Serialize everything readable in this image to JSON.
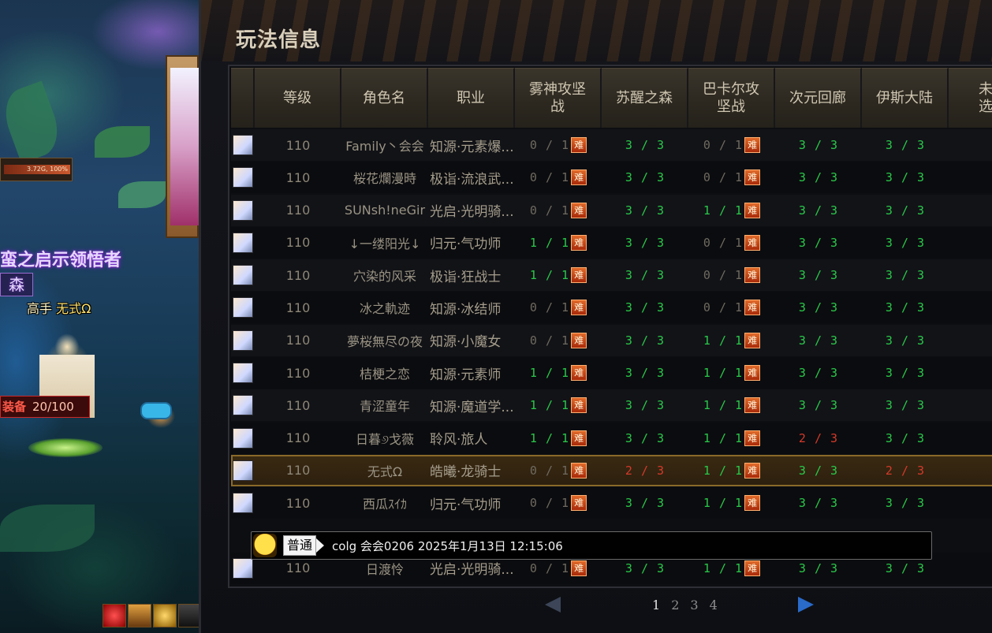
{
  "scene": {
    "gauge_text": "3.72G, 100%",
    "title": "蛮之启示领悟者",
    "subtitle": "森",
    "player_rank": "高手",
    "player_name": "无式Ω",
    "equip_label": "装备",
    "equip_count": "20/100"
  },
  "panel": {
    "title": "玩法信息",
    "headers": [
      "等级",
      "角色名",
      "职业",
      "雾神攻坚战",
      "苏醒之森",
      "巴卡尔攻坚战",
      "次元回廊",
      "伊斯大陆",
      "未选"
    ],
    "hard_tag": "难",
    "rows": [
      {
        "level": "110",
        "name": "Family丶会会",
        "job": "知源·元素爆...",
        "p1": "0 / 1",
        "p1c": "w",
        "p2": "3 / 3",
        "p2c": "g",
        "p3": "0 / 1",
        "p3c": "w",
        "p4": "3 / 3",
        "p4c": "g",
        "p5": "3 / 3",
        "p5c": "g",
        "last": "-"
      },
      {
        "level": "110",
        "name": "桜花爛漫時",
        "job": "极诣·流浪武...",
        "p1": "0 / 1",
        "p1c": "w",
        "p2": "3 / 3",
        "p2c": "g",
        "p3": "0 / 1",
        "p3c": "w",
        "p4": "3 / 3",
        "p4c": "g",
        "p5": "3 / 3",
        "p5c": "g",
        "last": "-"
      },
      {
        "level": "110",
        "name": "SUNsh!neGir",
        "job": "光启·光明骑...",
        "p1": "0 / 1",
        "p1c": "w",
        "p2": "3 / 3",
        "p2c": "g",
        "p3": "1 / 1",
        "p3c": "g",
        "p4": "3 / 3",
        "p4c": "g",
        "p5": "3 / 3",
        "p5c": "g",
        "last": "-"
      },
      {
        "level": "110",
        "name": "↓一缕阳光↓",
        "job": "归元·气功师",
        "p1": "1 / 1",
        "p1c": "g",
        "p2": "3 / 3",
        "p2c": "g",
        "p3": "0 / 1",
        "p3c": "w",
        "p4": "3 / 3",
        "p4c": "g",
        "p5": "3 / 3",
        "p5c": "g",
        "last": "-"
      },
      {
        "level": "110",
        "name": "穴染的风采",
        "job": "极诣·狂战士",
        "p1": "1 / 1",
        "p1c": "g",
        "p2": "3 / 3",
        "p2c": "g",
        "p3": "0 / 1",
        "p3c": "w",
        "p4": "3 / 3",
        "p4c": "g",
        "p5": "3 / 3",
        "p5c": "g",
        "last": "-"
      },
      {
        "level": "110",
        "name": "冰之軌迹",
        "job": "知源·冰结师",
        "p1": "0 / 1",
        "p1c": "w",
        "p2": "3 / 3",
        "p2c": "g",
        "p3": "0 / 1",
        "p3c": "w",
        "p4": "3 / 3",
        "p4c": "g",
        "p5": "3 / 3",
        "p5c": "g",
        "last": "-"
      },
      {
        "level": "110",
        "name": "夢桜無尽の夜",
        "job": "知源·小魔女",
        "p1": "0 / 1",
        "p1c": "w",
        "p2": "3 / 3",
        "p2c": "g",
        "p3": "1 / 1",
        "p3c": "g",
        "p4": "3 / 3",
        "p4c": "g",
        "p5": "3 / 3",
        "p5c": "g",
        "last": "-"
      },
      {
        "level": "110",
        "name": "桔梗之恋",
        "job": "知源·元素师",
        "p1": "1 / 1",
        "p1c": "g",
        "p2": "3 / 3",
        "p2c": "g",
        "p3": "1 / 1",
        "p3c": "g",
        "p4": "3 / 3",
        "p4c": "g",
        "p5": "3 / 3",
        "p5c": "g",
        "last": "-"
      },
      {
        "level": "110",
        "name": "青涩童年",
        "job": "知源·魔道学...",
        "p1": "1 / 1",
        "p1c": "g",
        "p2": "3 / 3",
        "p2c": "g",
        "p3": "1 / 1",
        "p3c": "g",
        "p4": "3 / 3",
        "p4c": "g",
        "p5": "3 / 3",
        "p5c": "g",
        "last": "-"
      },
      {
        "level": "110",
        "name": "日暮୬戈薇",
        "job": "聆风·旅人",
        "p1": "1 / 1",
        "p1c": "g",
        "p2": "3 / 3",
        "p2c": "g",
        "p3": "1 / 1",
        "p3c": "g",
        "p4": "2 / 3",
        "p4c": "r",
        "p5": "3 / 3",
        "p5c": "g",
        "last": "-"
      },
      {
        "level": "110",
        "name": "无式Ω",
        "job": "皓曦·龙骑士",
        "p1": "0 / 1",
        "p1c": "w",
        "p2": "2 / 3",
        "p2c": "r",
        "p3": "1 / 1",
        "p3c": "g",
        "p4": "3 / 3",
        "p4c": "g",
        "p5": "2 / 3",
        "p5c": "r",
        "last": "-",
        "me": true
      },
      {
        "level": "110",
        "name": "西瓜ｽｲｶ",
        "job": "归元·气功师",
        "p1": "0 / 1",
        "p1c": "w",
        "p2": "3 / 3",
        "p2c": "g",
        "p3": "1 / 1",
        "p3c": "g",
        "p4": "3 / 3",
        "p4c": "g",
        "p5": "3 / 3",
        "p5c": "g",
        "last": "-"
      },
      {
        "level": "",
        "name": "",
        "job": "",
        "p1": "",
        "p1c": "w",
        "p2": "",
        "p2c": "g",
        "p3": "",
        "p3c": "g",
        "p4": "",
        "p4c": "g",
        "p5": "",
        "p5c": "g",
        "last": "",
        "hidden": true
      },
      {
        "level": "110",
        "name": "日渡怜",
        "job": "光启·光明骑...",
        "p1": "0 / 1",
        "p1c": "w",
        "p2": "3 / 3",
        "p2c": "g",
        "p3": "1 / 1",
        "p3c": "g",
        "p4": "3 / 3",
        "p4c": "g",
        "p5": "3 / 3",
        "p5c": "g",
        "last": "-"
      }
    ],
    "pages": [
      "1",
      "2",
      "3",
      "4"
    ],
    "active_page": "1"
  },
  "chat": {
    "channel": "普通",
    "text": "colg 会会0206 2025年1月13日 12:15:06"
  },
  "colors": {
    "green": "#29c94a",
    "red": "#d43a2a",
    "accent_gold": "#8a6a2a"
  }
}
